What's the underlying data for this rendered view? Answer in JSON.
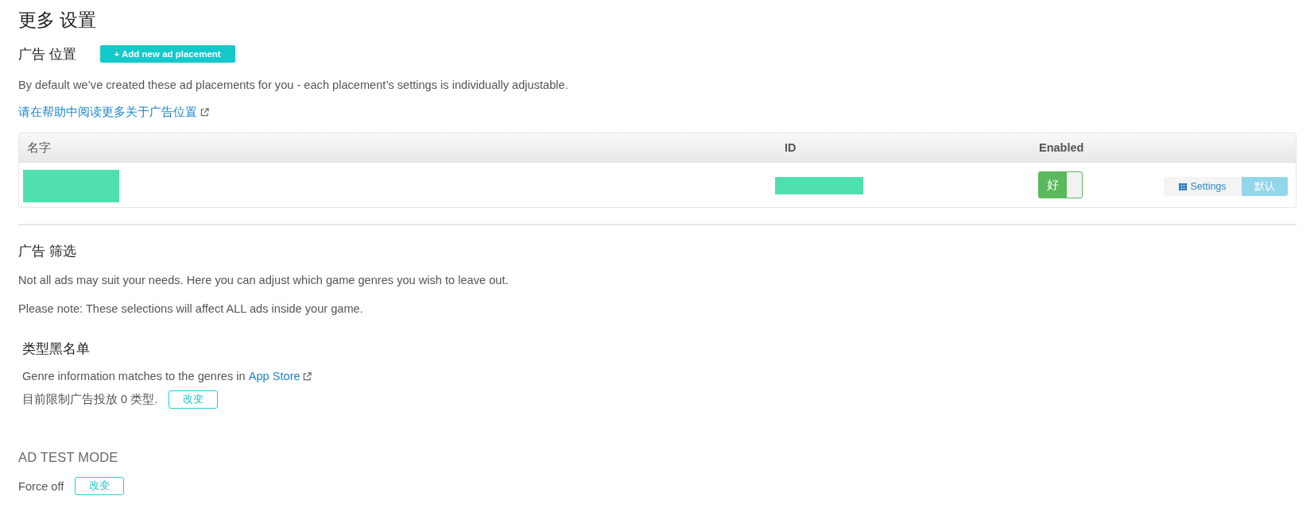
{
  "page": {
    "title": "更多 设置"
  },
  "ad_placements": {
    "heading": "广告 位置",
    "add_button": "+ Add new ad placement",
    "description": "By default we’ve created these ad placements for you - each placement’s settings is individually adjustable.",
    "help_link": "请在帮助中阅读更多关于广告位置"
  },
  "table": {
    "columns": [
      "名字",
      "ID",
      "Enabled"
    ],
    "rows": [
      {
        "enabled_toggle": {
          "label": "好",
          "on": true
        },
        "settings_button": "Settings",
        "default_button": "默认"
      }
    ]
  },
  "ad_filter": {
    "heading": "广告 筛选",
    "paragraphs": [
      "Not all ads may suit your needs. Here you can adjust which game genres you wish to leave out.",
      "Please note: These selections will affect ALL ads inside your game."
    ],
    "genre_blacklist": {
      "heading": "类型黑名单",
      "info_text": "Genre information matches to the genres in",
      "store_link": "App Store",
      "status_text": "目前限制广告投放 0 类型.",
      "change_button": "改变"
    }
  },
  "ad_test_mode": {
    "heading": "AD TEST MODE",
    "status": "Force off",
    "change_button": "改变"
  }
}
